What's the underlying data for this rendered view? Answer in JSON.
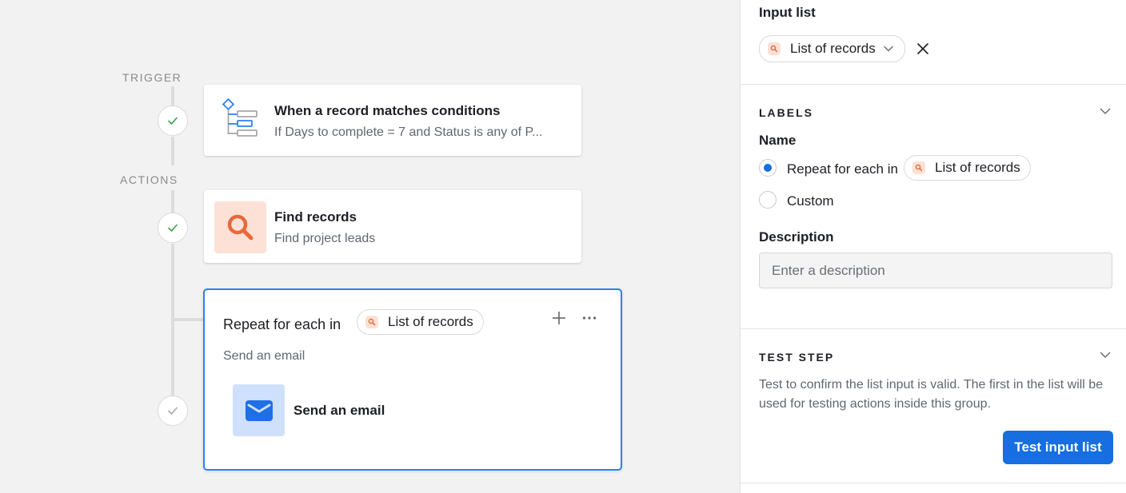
{
  "canvas": {
    "trigger_label": "TRIGGER",
    "actions_label": "ACTIONS",
    "trigger_card": {
      "title": "When a record matches conditions",
      "subtitle": "If Days to complete = 7 and Status is any of P...",
      "icon": "conditions-tree-icon"
    },
    "find_card": {
      "title": "Find records",
      "subtitle": "Find project leads",
      "icon": "search-icon"
    },
    "repeat_card": {
      "title": "Repeat for each in",
      "list_pill": "List of records",
      "subtitle": "Send an email",
      "add_icon": "plus-icon",
      "more_icon": "more-icon",
      "child": {
        "label": "Send an email",
        "icon": "envelope-icon"
      }
    }
  },
  "panel": {
    "input_list": {
      "heading": "Input list",
      "selected": "List of records"
    },
    "labels": {
      "heading": "LABELS",
      "name_heading": "Name",
      "option_repeat": "Repeat for each in",
      "option_repeat_pill": "List of records",
      "option_custom": "Custom",
      "selected_option": "repeat",
      "description_heading": "Description",
      "description_placeholder": "Enter a description",
      "description_value": ""
    },
    "test_step": {
      "heading": "TEST STEP",
      "help": "Test to confirm the list input is valid. The first in the list will be used for testing actions inside this group.",
      "button_label": "Test input list"
    }
  },
  "colors": {
    "accent": "#166ee1",
    "check_green": "#3aa04d",
    "find_icon_bg": "#fde1d6",
    "find_icon_fg": "#e8693a",
    "email_icon_bg": "#cfe0fc",
    "email_icon_fg": "#1f6fe5",
    "selected_border": "#2d7ff9"
  }
}
